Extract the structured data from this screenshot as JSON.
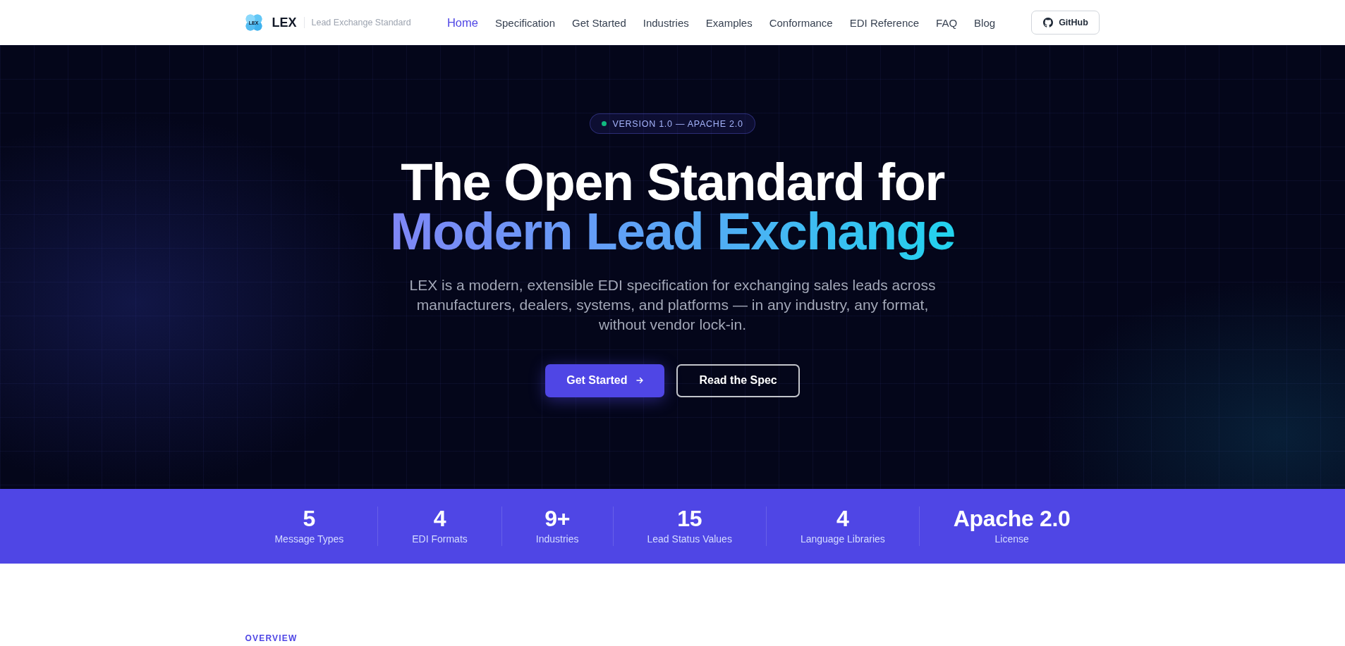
{
  "header": {
    "logo_mark": "LEX",
    "brand": "LEX",
    "tagline": "Lead Exchange Standard",
    "nav": [
      {
        "label": "Home",
        "selected": true
      },
      {
        "label": "Specification",
        "selected": false
      },
      {
        "label": "Get Started",
        "selected": false
      },
      {
        "label": "Industries",
        "selected": false
      },
      {
        "label": "Examples",
        "selected": false
      },
      {
        "label": "Conformance",
        "selected": false
      },
      {
        "label": "EDI Reference",
        "selected": false
      },
      {
        "label": "FAQ",
        "selected": false
      },
      {
        "label": "Blog",
        "selected": false
      }
    ],
    "github_button": "GitHub"
  },
  "hero": {
    "badge": "VERSION 1.0 — APACHE 2.0",
    "title": "The Open Standard for",
    "title_highlight": "Modern Lead Exchange",
    "description": "LEX is a modern, extensible EDI specification for exchanging sales leads across manufacturers, dealers, systems, and platforms — in any industry, any format, without vendor lock-in.",
    "buttons": [
      {
        "label": "Get Started",
        "kind": "primary"
      },
      {
        "label": "Read the Spec",
        "kind": "outline"
      }
    ]
  },
  "stats": [
    {
      "value": "5",
      "label": "Message Types"
    },
    {
      "value": "4",
      "label": "EDI Formats"
    },
    {
      "value": "9+",
      "label": "Industries"
    },
    {
      "value": "15",
      "label": "Lead Status Values"
    },
    {
      "value": "4",
      "label": "Language Libraries"
    },
    {
      "value": "Apache 2.0",
      "label": "License"
    }
  ],
  "overview": {
    "eyebrow": "OVERVIEW"
  }
}
